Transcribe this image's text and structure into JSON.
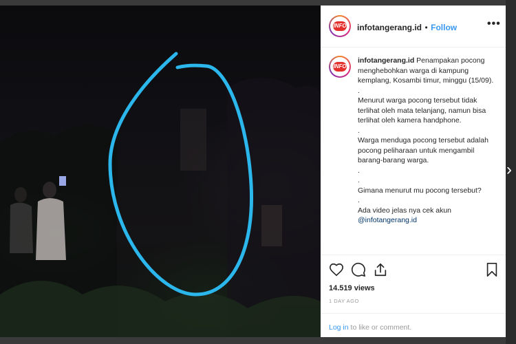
{
  "post": {
    "username": "infotangerang.id",
    "follow_label": "Follow",
    "separator": "•",
    "avatar_text": "INFO",
    "caption_username": "infotangerang.id",
    "caption_lines": [
      "Penampakan pocong menghebohkan warga di kampung kemplang, Kosambi timur, minggu (15/09).",
      ".",
      "Menurut warga pocong tersebut tidak terlihat oleh mata telanjang, namun bisa terlihat oleh kamera handphone.",
      ".",
      "Warga menduga pocong tersebut adalah pocong peliharaan untuk mengambil barang-barang warga.",
      ".",
      ".",
      "Gimana menurut mu pocong tersebut?",
      ".",
      "Ada video jelas nya cek akun"
    ],
    "mention": "@infotangerang.id",
    "views": "14.519 views",
    "time": "1 DAY AGO",
    "login_link": "Log in",
    "login_rest": " to like or comment."
  },
  "icons": {
    "more": "more-options-icon",
    "heart": "heart-icon",
    "comment": "comment-icon",
    "share": "share-icon",
    "bookmark": "bookmark-icon",
    "next": "chevron-right-icon"
  },
  "colors": {
    "link": "#3897f0",
    "circle": "#2bb6ec",
    "avatar_logo": "#e4302c"
  }
}
